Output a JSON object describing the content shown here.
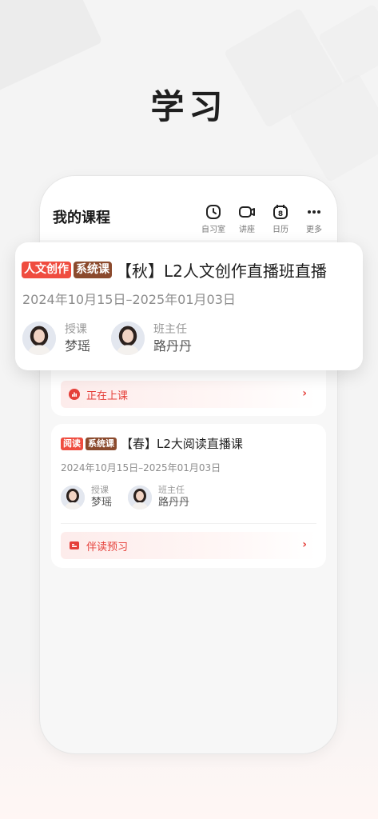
{
  "page": {
    "title": "学习"
  },
  "phone": {
    "title": "我的课程",
    "shortcuts": [
      {
        "label": "自习室",
        "icon": "clock-icon"
      },
      {
        "label": "讲座",
        "icon": "video-icon"
      },
      {
        "label": "日历",
        "icon": "calendar-icon",
        "badge": "8"
      },
      {
        "label": "更多",
        "icon": "more-icon"
      }
    ]
  },
  "featured_course": {
    "tags": [
      "人文创作",
      "系统课"
    ],
    "title": "【秋】L2人文创作直播班直播",
    "date_range": "2024年10月15日–2025年01月03日",
    "teachers": [
      {
        "role": "授课",
        "name": "梦瑶"
      },
      {
        "role": "班主任",
        "name": "路丹丹"
      }
    ],
    "action": {
      "label": "正在上课",
      "icon": "live-chart-icon"
    }
  },
  "course2": {
    "tags": [
      "阅读",
      "系统课"
    ],
    "title": "【春】L2大阅读直播课",
    "date_range": "2024年10月15日–2025年01月03日",
    "teachers": [
      {
        "role": "授课",
        "name": "梦瑶"
      },
      {
        "role": "班主任",
        "name": "路丹丹"
      }
    ],
    "action": {
      "label": "伴读预习",
      "icon": "book-icon"
    }
  },
  "colors": {
    "accent": "#e5403a",
    "tag_red": "#ef4c3f",
    "tag_brown": "#8b4a2d"
  }
}
